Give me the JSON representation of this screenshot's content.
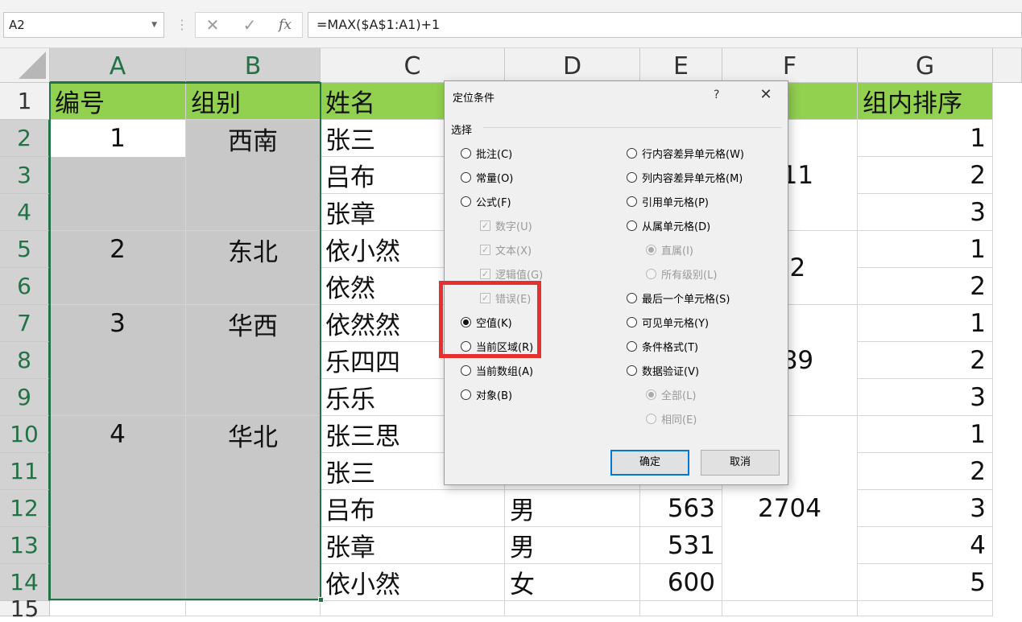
{
  "formula_bar": {
    "name_box": "A2",
    "cancel_symbol": "✕",
    "enter_symbol": "✓",
    "fx_symbol": "fx",
    "formula": "=MAX($A$1:A1)+1"
  },
  "columns": [
    "A",
    "B",
    "C",
    "D",
    "E",
    "F",
    "G"
  ],
  "selected_columns": [
    "A",
    "B"
  ],
  "rows": [
    "1",
    "2",
    "3",
    "4",
    "5",
    "6",
    "7",
    "8",
    "9",
    "10",
    "11",
    "12",
    "13",
    "14",
    "15"
  ],
  "header_row": {
    "A": "编号",
    "B": "组别",
    "C": "姓名",
    "G": "组内排序"
  },
  "merged_groups": [
    {
      "number": "1",
      "group": "西南",
      "f_value": "511"
    },
    {
      "number": "2",
      "group": "东北",
      "f_value": "62"
    },
    {
      "number": "3",
      "group": "华西",
      "f_value": "989"
    },
    {
      "number": "4",
      "group": "华北",
      "f_value": "2704"
    }
  ],
  "names": [
    "张三",
    "吕布",
    "张章",
    "依小然",
    "依然",
    "依然然",
    "乐四四",
    "乐乐",
    "张三思",
    "张三",
    "吕布",
    "张章",
    "依小然"
  ],
  "col_d": {
    "12": "男",
    "13": "男",
    "14": "女"
  },
  "col_e": {
    "12": "563",
    "13": "531",
    "14": "600"
  },
  "rank": [
    "1",
    "2",
    "3",
    "1",
    "2",
    "1",
    "2",
    "3",
    "1",
    "2",
    "3",
    "4",
    "5"
  ],
  "dialog": {
    "title": "定位条件",
    "help": "?",
    "close": "✕",
    "group_label": "选择",
    "left_options": [
      {
        "label": "批注(C)",
        "type": "radio",
        "checked": false,
        "disabled": false
      },
      {
        "label": "常量(O)",
        "type": "radio",
        "checked": false,
        "disabled": false
      },
      {
        "label": "公式(F)",
        "type": "radio",
        "checked": false,
        "disabled": false
      },
      {
        "label": "数字(U)",
        "type": "checkbox",
        "checked": true,
        "disabled": true
      },
      {
        "label": "文本(X)",
        "type": "checkbox",
        "checked": true,
        "disabled": true
      },
      {
        "label": "逻辑值(G)",
        "type": "checkbox",
        "checked": true,
        "disabled": true
      },
      {
        "label": "错误(E)",
        "type": "checkbox",
        "checked": true,
        "disabled": true
      },
      {
        "label": "空值(K)",
        "type": "radio",
        "checked": true,
        "disabled": false
      },
      {
        "label": "当前区域(R)",
        "type": "radio",
        "checked": false,
        "disabled": false
      },
      {
        "label": "当前数组(A)",
        "type": "radio",
        "checked": false,
        "disabled": false
      },
      {
        "label": "对象(B)",
        "type": "radio",
        "checked": false,
        "disabled": false
      }
    ],
    "right_options": [
      {
        "label": "行内容差异单元格(W)",
        "type": "radio",
        "checked": false,
        "disabled": false
      },
      {
        "label": "列内容差异单元格(M)",
        "type": "radio",
        "checked": false,
        "disabled": false
      },
      {
        "label": "引用单元格(P)",
        "type": "radio",
        "checked": false,
        "disabled": false
      },
      {
        "label": "从属单元格(D)",
        "type": "radio",
        "checked": false,
        "disabled": false
      },
      {
        "label": "直属(I)",
        "type": "radio",
        "checked": true,
        "disabled": true
      },
      {
        "label": "所有级别(L)",
        "type": "radio",
        "checked": false,
        "disabled": true
      },
      {
        "label": "最后一个单元格(S)",
        "type": "radio",
        "checked": false,
        "disabled": false
      },
      {
        "label": "可见单元格(Y)",
        "type": "radio",
        "checked": false,
        "disabled": false
      },
      {
        "label": "条件格式(T)",
        "type": "radio",
        "checked": false,
        "disabled": false
      },
      {
        "label": "数据验证(V)",
        "type": "radio",
        "checked": false,
        "disabled": false
      },
      {
        "label": "全部(L)",
        "type": "radio",
        "checked": true,
        "disabled": true
      },
      {
        "label": "相同(E)",
        "type": "radio",
        "checked": false,
        "disabled": true
      }
    ],
    "ok_button": "确定",
    "cancel_button": "取消"
  },
  "colors": {
    "header_green": "#92d050",
    "selection_gray": "#c8c8c8",
    "excel_green": "#217346",
    "highlight_red": "#e53030"
  }
}
